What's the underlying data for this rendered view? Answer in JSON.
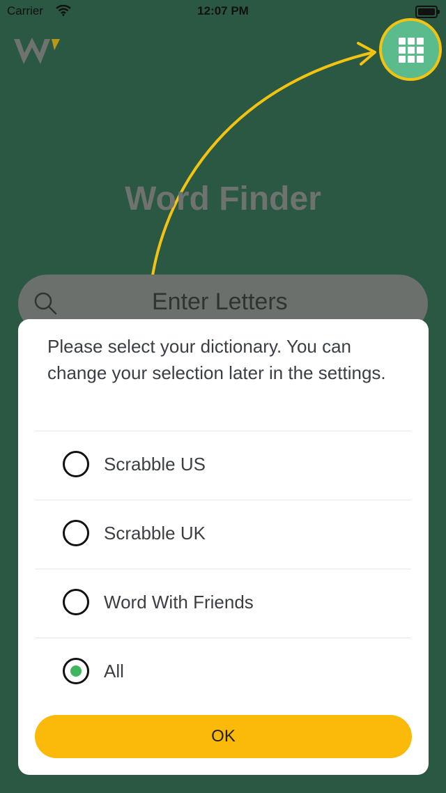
{
  "status_bar": {
    "carrier": "Carrier",
    "time": "12:07 PM"
  },
  "header": {
    "logo_icon": "w-logo-icon",
    "menu_icon": "grid-icon"
  },
  "app_title": "Word Finder",
  "search": {
    "placeholder": "Enter Letters",
    "icon": "search-icon"
  },
  "dialog": {
    "message": "Please select your dictionary. You can change your selection later in the settings.",
    "options": [
      {
        "label": "Scrabble US",
        "selected": false
      },
      {
        "label": "Scrabble UK",
        "selected": false
      },
      {
        "label": "Word With Friends",
        "selected": false
      },
      {
        "label": "All",
        "selected": true
      }
    ],
    "ok_label": "OK"
  },
  "colors": {
    "background": "#2a5842",
    "accent_green": "#5cbb8c",
    "highlight_yellow": "#f3c311",
    "ok_button": "#fbb90a",
    "radio_selected": "#3fb55e"
  }
}
